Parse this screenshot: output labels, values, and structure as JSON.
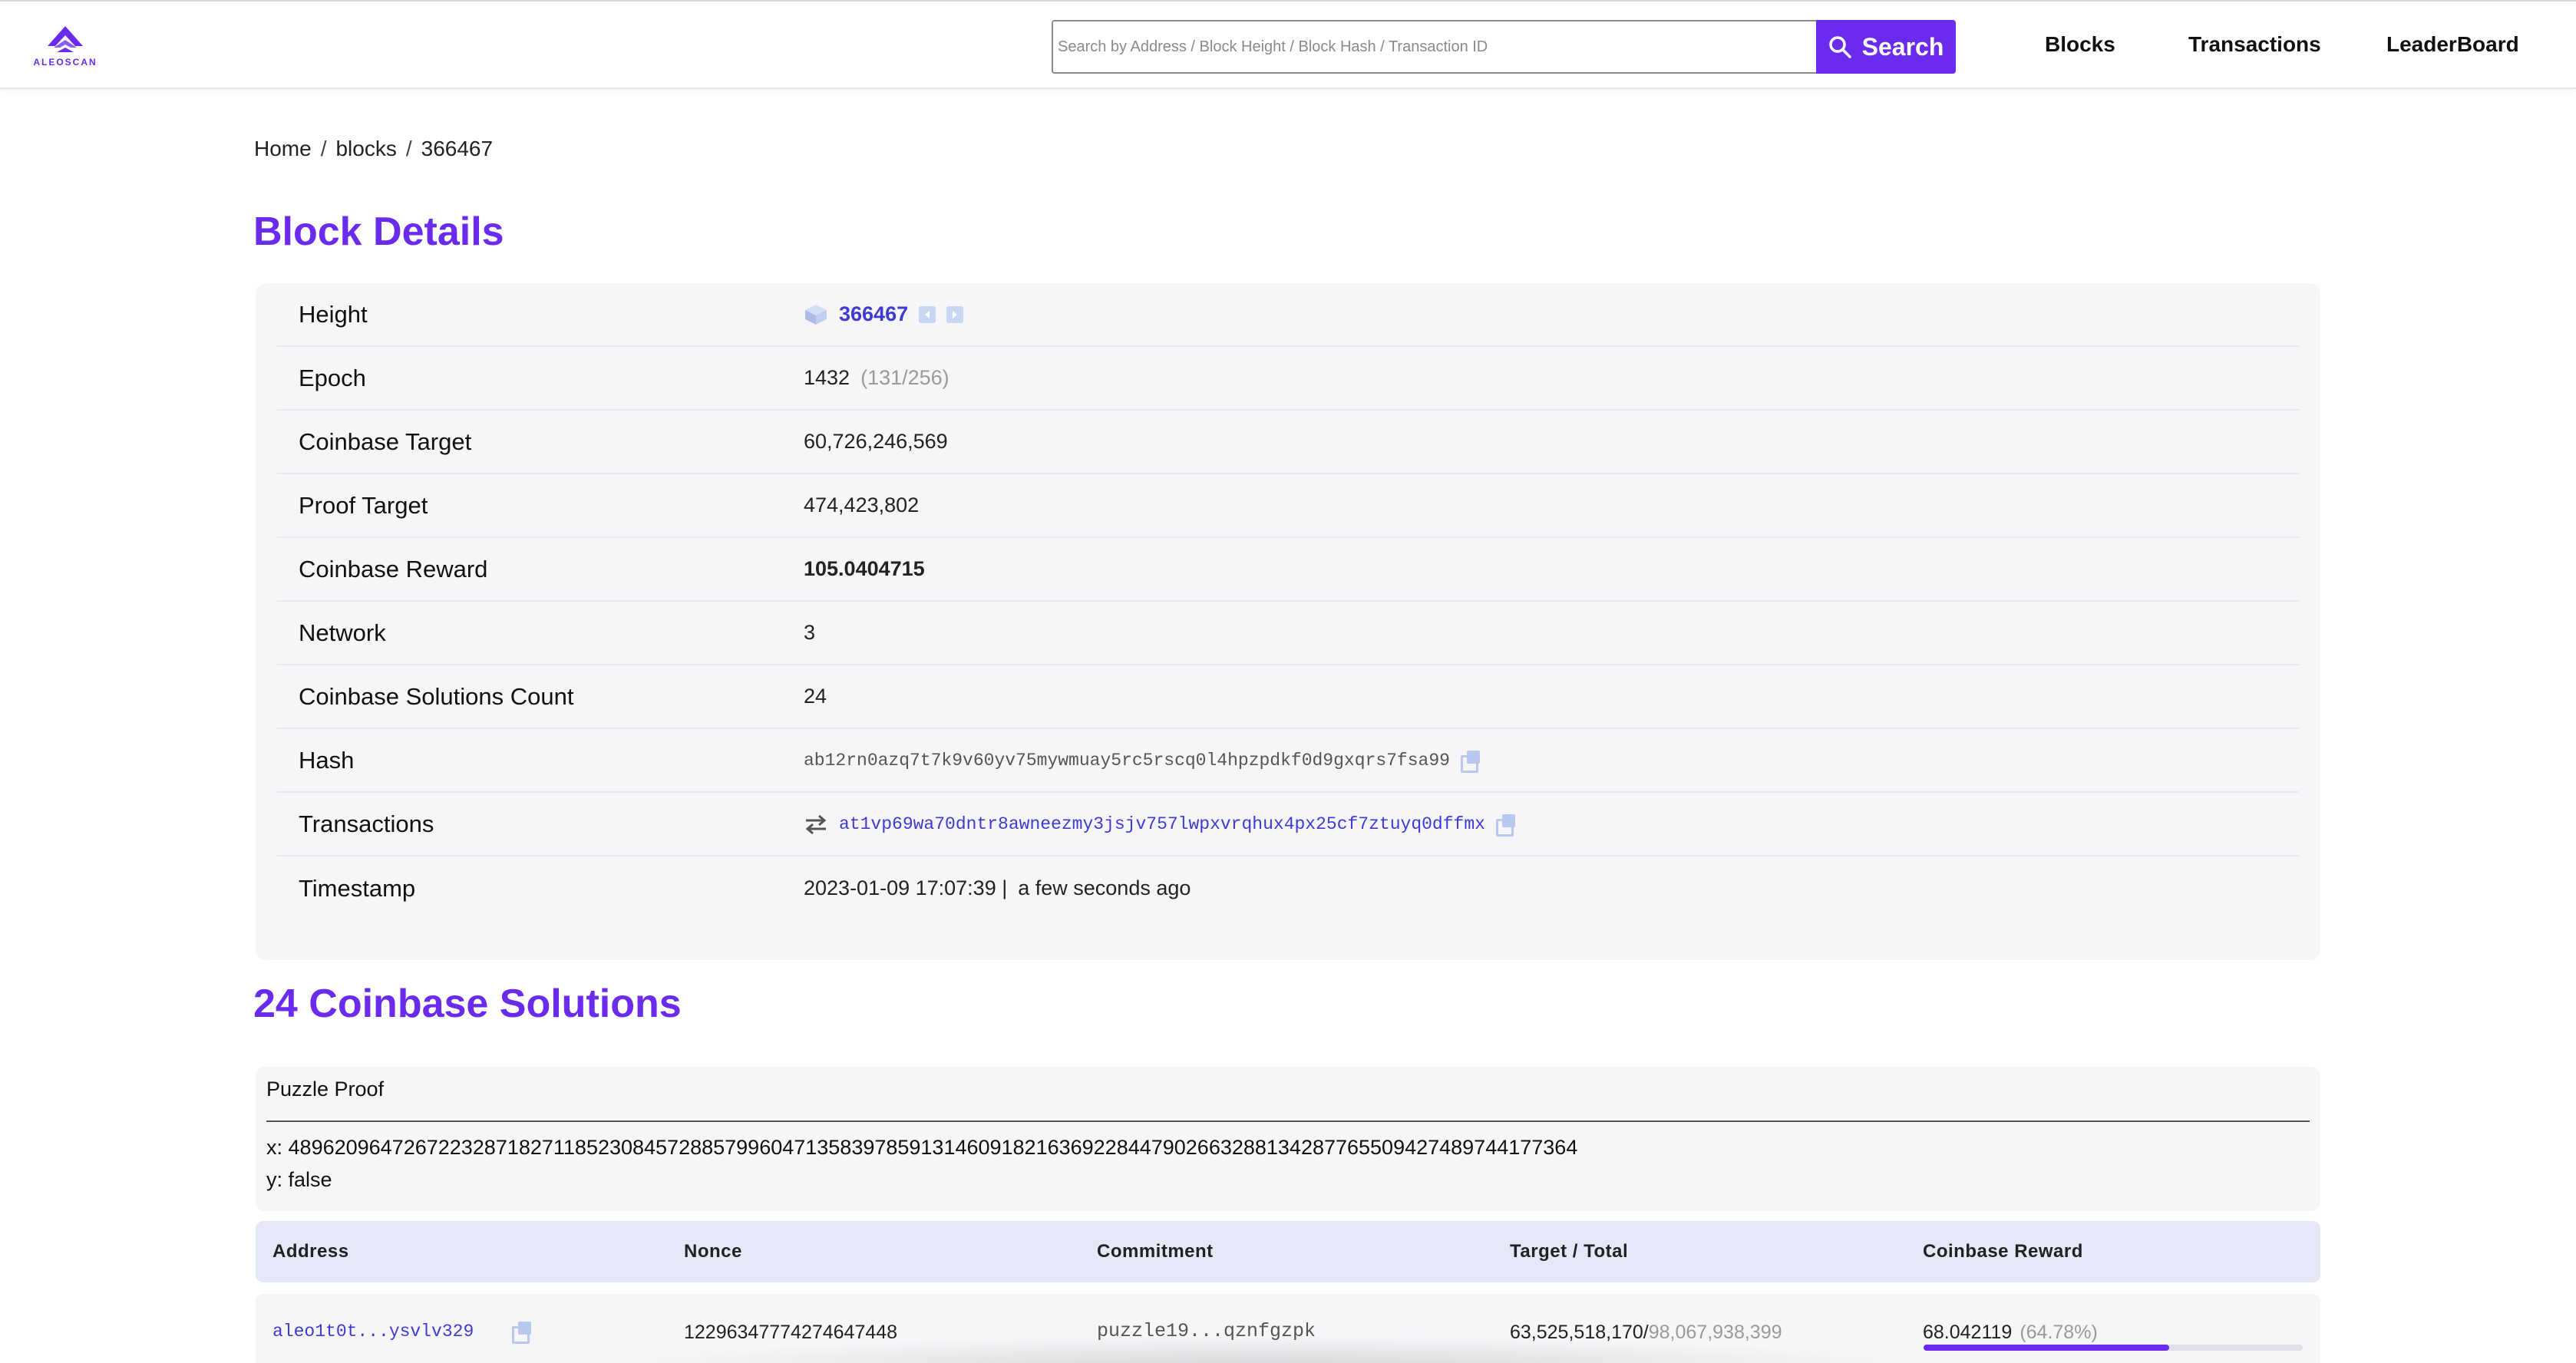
{
  "brand": {
    "logo_text": "ALEOSCAN",
    "accent": "#6b2bee"
  },
  "search": {
    "placeholder": "Search by Address / Block Height / Block Hash / Transaction ID",
    "button_label": "Search"
  },
  "nav": {
    "items": [
      "Blocks",
      "Transactions",
      "LeaderBoard"
    ]
  },
  "breadcrumb": {
    "items": [
      "Home",
      "blocks",
      "366467"
    ],
    "separator": "/"
  },
  "block_details": {
    "title": "Block Details",
    "rows": {
      "height": {
        "label": "Height",
        "value": "366467"
      },
      "epoch": {
        "label": "Epoch",
        "value": "1432",
        "extra": "(131/256)"
      },
      "coinbase_target": {
        "label": "Coinbase Target",
        "value": "60,726,246,569"
      },
      "proof_target": {
        "label": "Proof Target",
        "value": "474,423,802"
      },
      "coinbase_reward": {
        "label": "Coinbase Reward",
        "value": "105.0404715"
      },
      "network": {
        "label": "Network",
        "value": "3"
      },
      "solutions_count": {
        "label": "Coinbase Solutions Count",
        "value": "24"
      },
      "hash": {
        "label": "Hash",
        "value": "ab12rn0azq7t7k9v60yv75mywmuay5rc5rscq0l4hpzpdkf0d9gxqrs7fsa99"
      },
      "transactions": {
        "label": "Transactions",
        "value": "at1vp69wa70dntr8awneezmy3jsjv757lwpxvrqhux4px25cf7ztuyq0dffmx"
      },
      "timestamp": {
        "label": "Timestamp",
        "value": "2023-01-09 17:07:39 |",
        "relative": "a few seconds ago"
      }
    }
  },
  "solutions": {
    "title": "24 Coinbase Solutions",
    "puzzle_proof": {
      "title": "Puzzle Proof",
      "x_label": "x:",
      "x": "48962096472672232871827118523084572885799604713583978591314609182163692284479026632881342877655094274897441773​64",
      "y_label": "y:",
      "y": "false"
    },
    "columns": [
      "Address",
      "Nonce",
      "Commitment",
      "Target / Total",
      "Coinbase Reward"
    ],
    "rows": [
      {
        "address": "aleo1t0t...ysvlv329",
        "nonce": "12296347774274647448",
        "commitment": "puzzle19...qznfgzpk",
        "target": "63,525,518,170/",
        "total": "98,067,938,399",
        "reward": "68.042119",
        "reward_pct": "(64.78%)",
        "reward_fraction": 0.6478
      }
    ]
  }
}
